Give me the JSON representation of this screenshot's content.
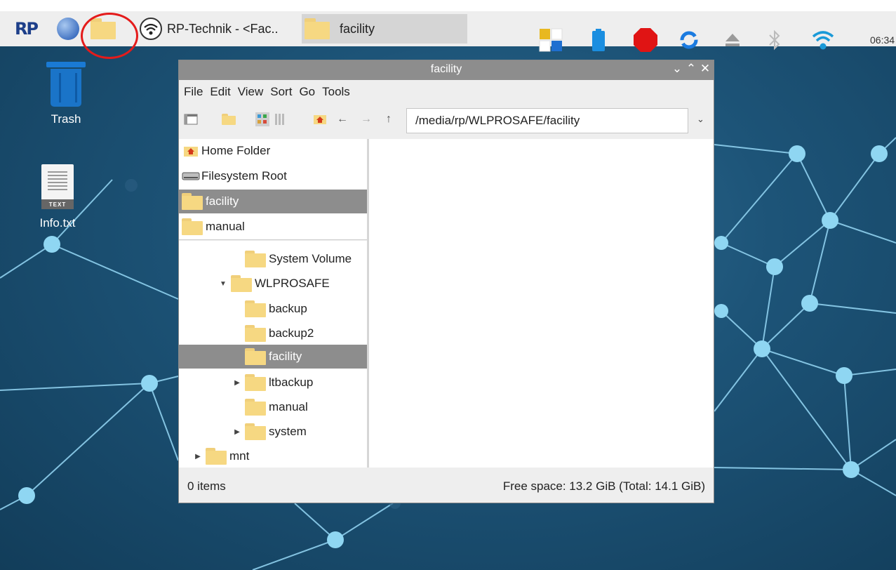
{
  "taskbar": {
    "launchers": [
      "raspberry-logo",
      "web-browser",
      "file-manager",
      "network-wifi"
    ],
    "rp_logo_text": "RP",
    "tasks": [
      {
        "label": "RP-Technik - <Fac..",
        "active": false
      },
      {
        "label": "facility",
        "active": true
      }
    ],
    "tray_icons": [
      "dual-status-icon",
      "battery-icon",
      "stop-icon",
      "sync-icon",
      "eject-icon",
      "bluetooth-icon",
      "wifi-icon"
    ],
    "clock": "06:34"
  },
  "desktop": {
    "icons": [
      {
        "label": "Trash",
        "icon": "trash-icon"
      },
      {
        "label": "Info.txt",
        "icon": "text-file-icon",
        "tag": "TEXT"
      }
    ]
  },
  "window": {
    "title": "facility",
    "controls": [
      "minimize",
      "maximize",
      "close"
    ],
    "menu": [
      "File",
      "Edit",
      "View",
      "Sort",
      "Go",
      "Tools"
    ],
    "path": "/media/rp/WLPROSAFE/facility",
    "places": [
      {
        "label": "Home Folder",
        "icon": "home-folder-icon",
        "selected": false
      },
      {
        "label": "Filesystem Root",
        "icon": "drive-icon",
        "selected": false
      },
      {
        "label": "facility",
        "icon": "folder-icon",
        "selected": true
      },
      {
        "label": "manual",
        "icon": "folder-icon",
        "selected": false
      }
    ],
    "tree": [
      {
        "label": "System Volume",
        "expander": "",
        "selected": false
      },
      {
        "label": "WLPROSAFE",
        "expander": "expanded",
        "selected": false
      },
      {
        "label": "backup",
        "expander": "",
        "selected": false
      },
      {
        "label": "backup2",
        "expander": "",
        "selected": false
      },
      {
        "label": "facility",
        "expander": "",
        "selected": true
      },
      {
        "label": "ltbackup",
        "expander": "collapsed",
        "selected": false
      },
      {
        "label": "manual",
        "expander": "",
        "selected": false
      },
      {
        "label": "system",
        "expander": "collapsed",
        "selected": false
      },
      {
        "label": "mnt",
        "expander": "collapsed",
        "selected": false
      }
    ],
    "status_left": "0 items",
    "status_right": "Free space: 13.2 GiB (Total: 14.1 GiB)"
  },
  "colors": {
    "desktop": "#1d5478",
    "taskbar": "#eeeeee",
    "selection": "#8d8d8d",
    "highlight_circle": "#e41b1b"
  }
}
